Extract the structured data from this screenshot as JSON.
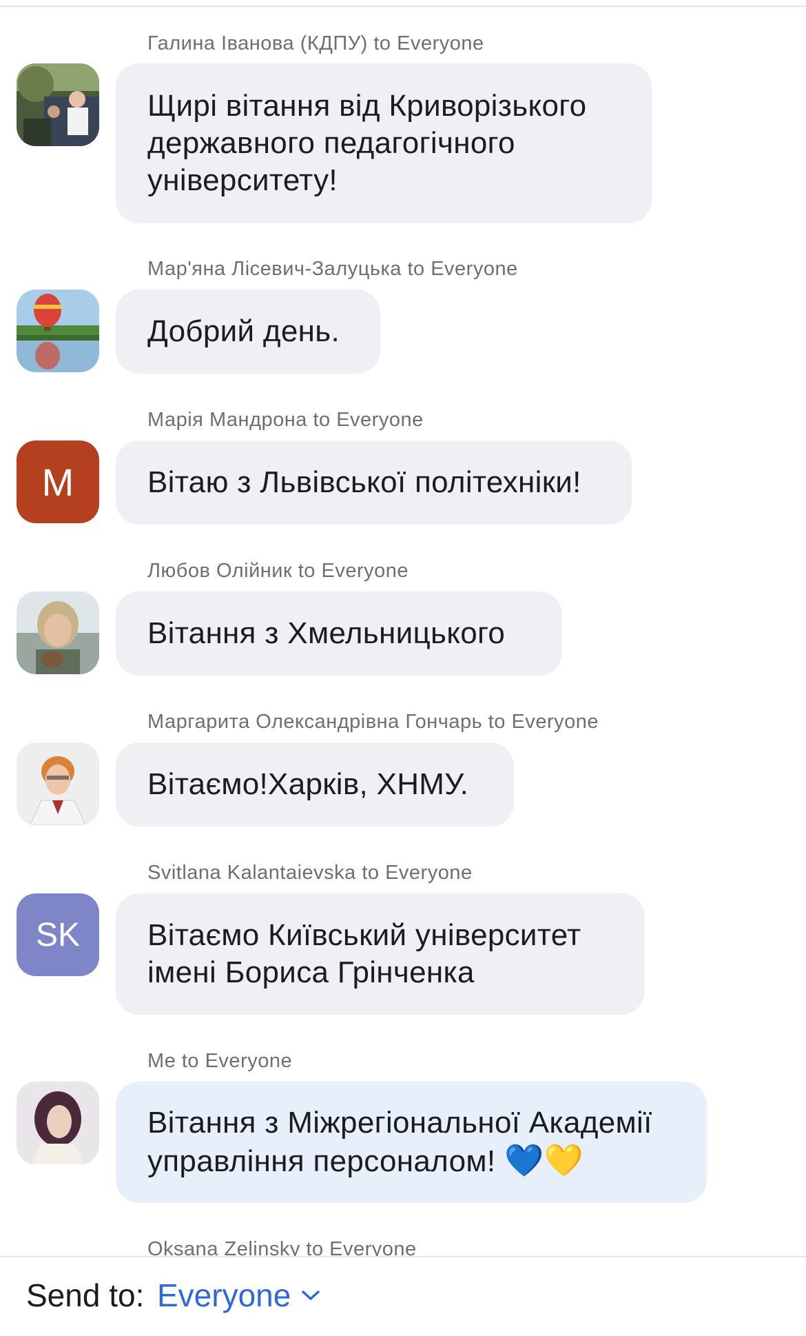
{
  "messages": [
    {
      "sender": "Галина Іванова (КДПУ) to Everyone",
      "lines": [
        "Щирі вітання від Криворізького",
        "державного педагогічного",
        "університету!"
      ],
      "avatar": "photo"
    },
    {
      "sender": "Мар'яна Лісевич-Залуцька to Everyone",
      "lines": [
        "Добрий день."
      ],
      "avatar": "photo"
    },
    {
      "sender": "Марія Мандрона to Everyone",
      "lines": [
        "Вітаю з Львівської політехніки!"
      ],
      "avatar": "initials",
      "initials": "M",
      "avatar_color": "#b5401f"
    },
    {
      "sender": "Любов  Олійник to Everyone",
      "lines": [
        "Вітання з Хмельницького"
      ],
      "avatar": "photo"
    },
    {
      "sender": "Маргарита Олександрівна Гончарь to Everyone",
      "lines": [
        "Вітаємо!Харків, ХНМУ."
      ],
      "avatar": "photo"
    },
    {
      "sender": "Svitlana Kalantaievska to Everyone",
      "lines": [
        "Вітаємо Київський університет",
        "імені Бориса Грінченка"
      ],
      "avatar": "initials",
      "initials": "SK",
      "avatar_color": "#7f86c8"
    },
    {
      "sender": "Me to Everyone",
      "lines": [
        "Вітання з Міжрегіональної Академії",
        "управління персоналом!"
      ],
      "hearts": [
        "💙",
        "💛"
      ],
      "avatar": "photo",
      "mine": true
    },
    {
      "sender": "Oksana Zelinsky to Everyone"
    }
  ],
  "footer": {
    "label": "Send to:",
    "value": "Everyone",
    "chevron_icon": "chevron-down-icon"
  },
  "colors": {
    "accent": "#2d6ad6",
    "bubble": "#efeff4",
    "bubble_mine": "#e7effb"
  }
}
